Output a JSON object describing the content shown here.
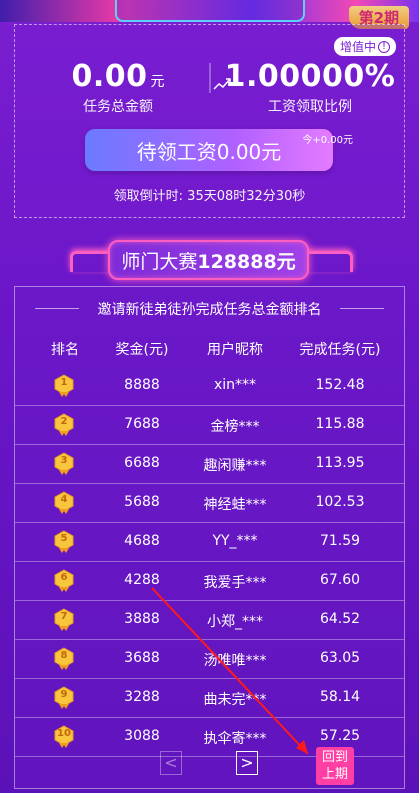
{
  "header": {
    "period_badge": "第2期"
  },
  "summary": {
    "badge": "增值中",
    "total_amount": "0.00",
    "total_unit": "元",
    "total_label": "任务总金额",
    "ratio": "1.00000%",
    "ratio_label": "工资领取比例",
    "claim_label": "待领工资0.00元",
    "today_plus": "今+0.00元",
    "countdown": "领取倒计时: 35天08时32分30秒"
  },
  "contest": {
    "title_prefix": "师门大赛",
    "title_amount": "128888元"
  },
  "ranking": {
    "title": "邀请新徒弟徒孙完成任务总金额排名",
    "columns": [
      "排名",
      "奖金(元)",
      "用户昵称",
      "完成任务(元)"
    ],
    "rows": [
      {
        "rank": "1",
        "prize": "8888",
        "name": "xin***",
        "task": "152.48"
      },
      {
        "rank": "2",
        "prize": "7688",
        "name": "金榜***",
        "task": "115.88"
      },
      {
        "rank": "3",
        "prize": "6688",
        "name": "趣闲赚***",
        "task": "113.95"
      },
      {
        "rank": "4",
        "prize": "5688",
        "name": "神经蛙***",
        "task": "102.53"
      },
      {
        "rank": "5",
        "prize": "4688",
        "name": "YY_***",
        "task": "71.59"
      },
      {
        "rank": "6",
        "prize": "4288",
        "name": "我爱手***",
        "task": "67.60"
      },
      {
        "rank": "7",
        "prize": "3888",
        "name": "小郑_***",
        "task": "64.52"
      },
      {
        "rank": "8",
        "prize": "3688",
        "name": "汤唯唯***",
        "task": "63.05"
      },
      {
        "rank": "9",
        "prize": "3288",
        "name": "曲未完***",
        "task": "58.14"
      },
      {
        "rank": "10",
        "prize": "3088",
        "name": "执伞寄***",
        "task": "57.25"
      }
    ]
  },
  "pager": {
    "prev": "<",
    "next": ">",
    "back_line1": "回到",
    "back_line2": "上期"
  },
  "colors": {
    "accent_pink": "#ff3fa3",
    "gold": "#f6a623",
    "bg_purple": "#6a16c8"
  }
}
